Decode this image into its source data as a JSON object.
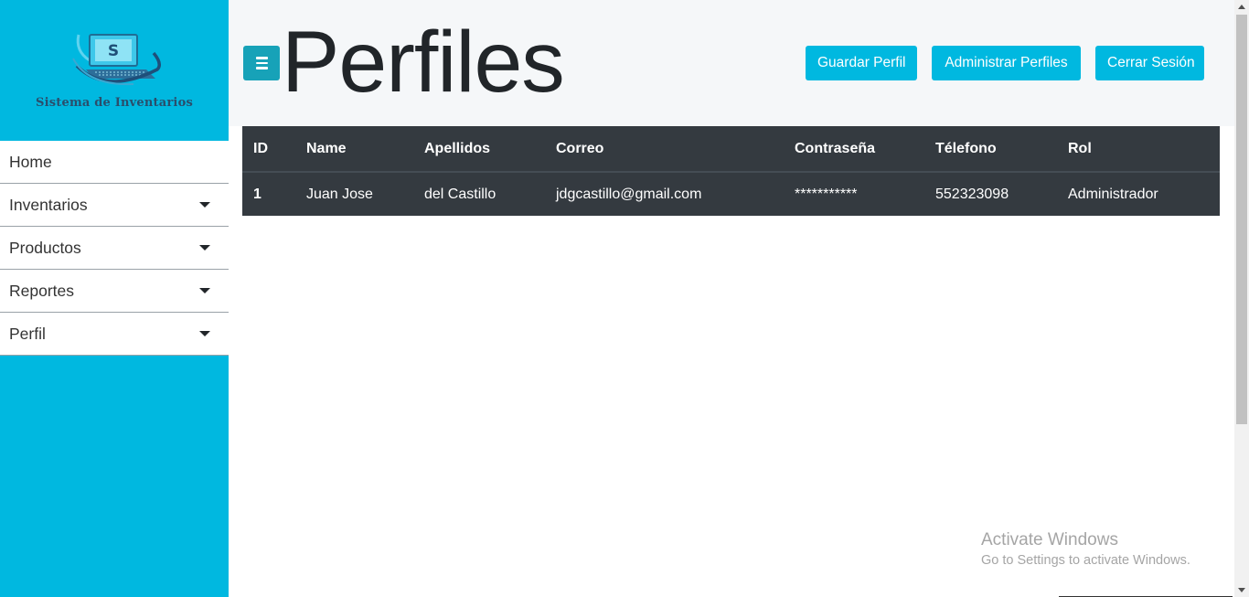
{
  "sidebar": {
    "logo_text": "Sistema de Inventarios",
    "items": [
      {
        "label": "Home",
        "has_dropdown": false
      },
      {
        "label": "Inventarios",
        "has_dropdown": true
      },
      {
        "label": "Productos",
        "has_dropdown": true
      },
      {
        "label": "Reportes",
        "has_dropdown": true
      },
      {
        "label": "Perfil",
        "has_dropdown": true
      }
    ]
  },
  "header": {
    "title": "Perfiles",
    "buttons": {
      "save": "Guardar Perfil",
      "admin": "Administrar Perfiles",
      "logout": "Cerrar Sesión"
    }
  },
  "table": {
    "columns": [
      "ID",
      "Name",
      "Apellidos",
      "Correo",
      "Contraseña",
      "Télefono",
      "Rol"
    ],
    "rows": [
      [
        "1",
        "Juan Jose",
        "del Castillo",
        "jdgcastillo@gmail.com",
        "***********",
        "552323098",
        "Administrador"
      ]
    ]
  },
  "watermark": {
    "title": "Activate Windows",
    "subtitle": "Go to Settings to activate Windows."
  },
  "colors": {
    "sidebar_bg": "#00b8e0",
    "button_bg": "#00b8e0",
    "toggle_bg": "#17a2b8",
    "table_bg": "#343a40"
  },
  "icons": {
    "toggle": "hamburger-menu-icon",
    "dropdown": "caret-down-icon",
    "logo": "computer-dollar-logo"
  }
}
